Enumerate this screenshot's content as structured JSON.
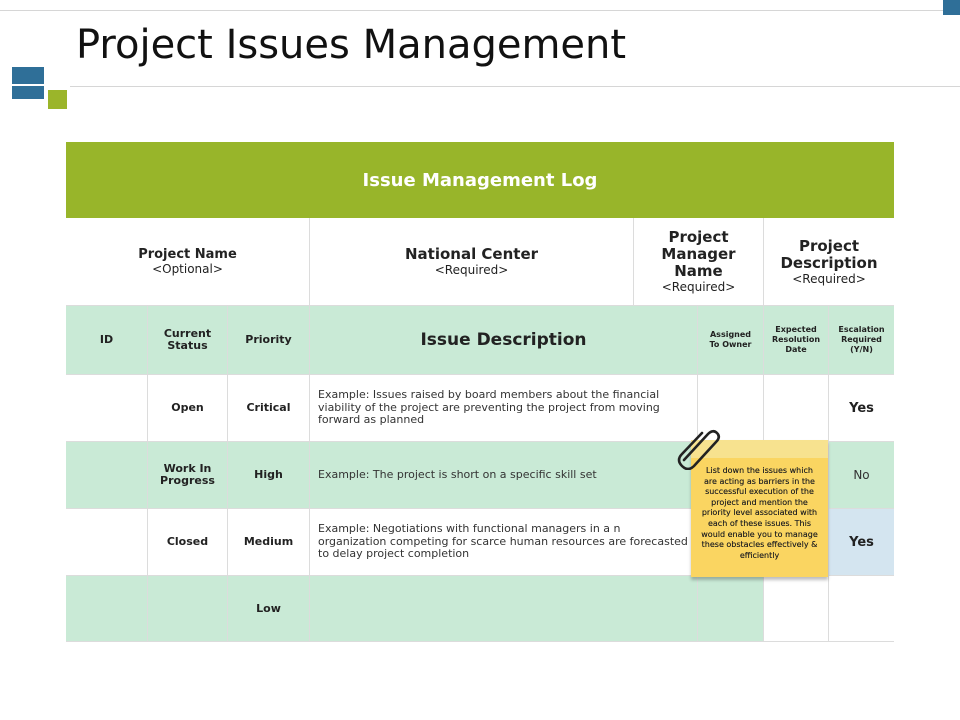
{
  "slide": {
    "title": "Project Issues Management"
  },
  "log": {
    "banner": "Issue Management Log",
    "info": [
      {
        "label": "Project Name",
        "note": "<Optional>"
      },
      {
        "label": "National Center",
        "note": "<Required>"
      },
      {
        "label": "Project Manager Name",
        "note": "<Required>"
      },
      {
        "label": "Project Description",
        "note": "<Required>"
      }
    ],
    "columns": {
      "id": "ID",
      "status": "Current Status",
      "priority": "Priority",
      "description": "Issue Description",
      "assigned": "Assigned To Owner",
      "resolution": "Expected Resolution Date",
      "escalation": "Escalation Required (Y/N)"
    },
    "rows": [
      {
        "status": "Open",
        "priority": "Critical",
        "description": "Example: Issues raised by board members about the financial viability of the project are preventing the project from moving forward as planned",
        "escalation": "Yes"
      },
      {
        "status": "Work In Progress",
        "priority": "High",
        "description": "Example: The project is short on a specific skill set",
        "escalation": "No"
      },
      {
        "status": "Closed",
        "priority": "Medium",
        "description": "Example: Negotiations with functional managers in a n organization competing for scarce human resources are forecasted to delay project completion",
        "escalation": "Yes"
      },
      {
        "status": "",
        "priority": "Low",
        "description": "",
        "escalation": ""
      }
    ]
  },
  "sticky_note": {
    "text": "List down the issues which are acting as barriers in the successful execution of the project and mention the priority level associated with each of these issues. This would enable you to manage these obstacles effectively & efficiently"
  },
  "colors": {
    "banner_green": "#98b52a",
    "mint": "#c9ead6",
    "accent_blue": "#2f6f98",
    "note_yellow": "#fad561"
  },
  "icons": [
    "paperclip-icon"
  ]
}
